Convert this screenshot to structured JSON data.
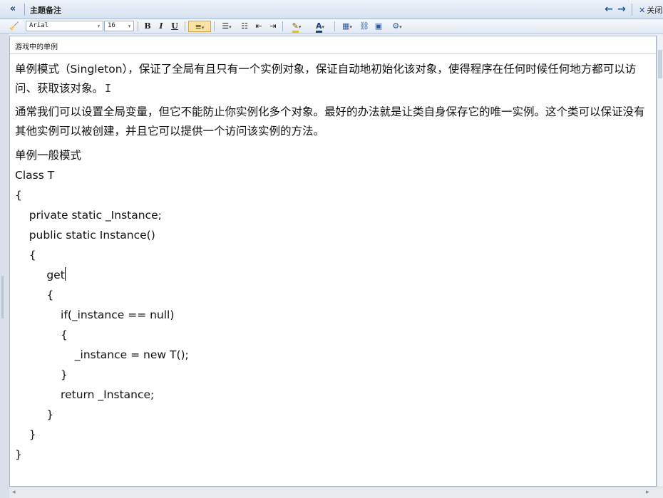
{
  "titlebar": {
    "collapse_icon": "«",
    "title": "主题备注",
    "prev_icon": "←",
    "next_icon": "→",
    "close_icon": "✕",
    "close_label": "关闭"
  },
  "toolbar": {
    "format_painter_icon": "🧹",
    "font_name": "Arial",
    "font_size": "16",
    "bold": "B",
    "italic": "I",
    "underline": "U",
    "align_icon": "≡",
    "numbered_list_icon": "☰",
    "bullet_list_icon": "☷",
    "outdent_icon": "⇤",
    "indent_icon": "⇥",
    "highlight_icon": "✎",
    "font_color_icon": "A",
    "table_icon": "▦",
    "link_icon": "⛓",
    "image_icon": "▣",
    "more_icon": "⚙",
    "dropdown_arrow": "▾"
  },
  "editor": {
    "subject": "游戏中的单例",
    "paragraphs": [
      "单例模式（Singleton），保证了全局有且只有一个实例对象，保证自动地初始化该对象，使得程序在任何时候任何地方都可以访问、获取该对象。",
      "通常我们可以设置全局变量，但它不能防止你实例化多个对象。最好的办法就是让类自身保存它的唯一实例。这个类可以保证没有其他实例可以被创建，并且它可以提供一个访问该实例的方法。"
    ],
    "code_lines": [
      "单例一般模式",
      "Class T",
      "{",
      "    private static _Instance;",
      "    public static Instance()",
      "    {",
      "         get",
      "         {",
      "             if(_instance == null)",
      "             {",
      "                 _instance = new T();",
      "             }",
      "             return _Instance;",
      "         }",
      "    }",
      "}"
    ]
  },
  "scroll": {
    "left_arrow": "◂",
    "right_arrow": "▸"
  },
  "colors": {
    "titlebar_bg": "#dde6f2",
    "accent": "#1d4f9a",
    "active_tool_bg": "#fbe3a5"
  }
}
